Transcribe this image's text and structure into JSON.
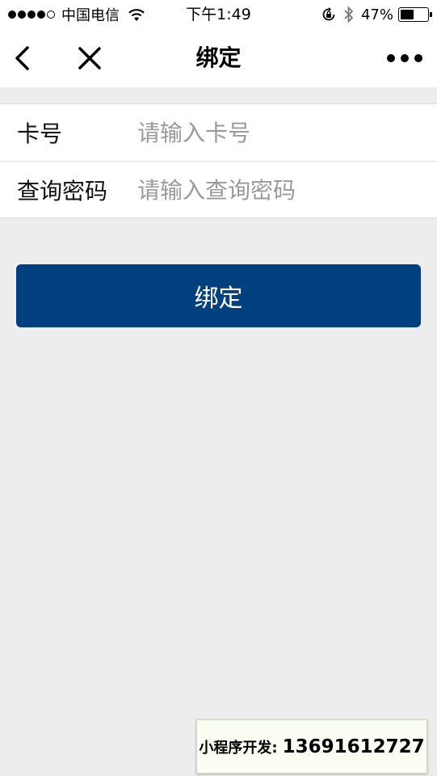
{
  "status_bar": {
    "carrier": "中国电信",
    "time": "下午1:49",
    "battery_percent": "47%",
    "battery_level": 0.47,
    "signal_bars_filled": 4,
    "signal_bars_total": 5
  },
  "nav": {
    "title": "绑定",
    "back_icon": "chevron-left-icon",
    "close_icon": "close-icon",
    "more_icon": "more-dots-icon"
  },
  "form": {
    "card_label": "卡号",
    "card_placeholder": "请输入卡号",
    "card_value": "",
    "password_label": "查询密码",
    "password_placeholder": "请输入查询密码",
    "password_value": ""
  },
  "bind_button": {
    "label": "绑定",
    "color": "#01407f"
  },
  "dev_badge": {
    "label": "小程序开发:",
    "phone": "13691612727"
  }
}
